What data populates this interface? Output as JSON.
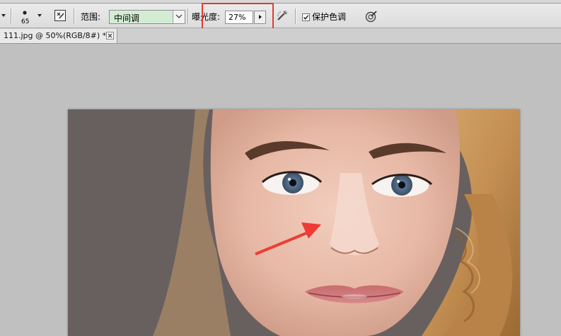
{
  "options_bar": {
    "brush_size": "65",
    "range_label": "范围:",
    "range_value": "中间调",
    "exposure_label": "曝光度:",
    "exposure_value": "27%",
    "protect_tones_label": "保护色调",
    "protect_tones_checked": true
  },
  "document_tab": {
    "title": "111.jpg @ 50%(RGB/8#) *"
  },
  "colors": {
    "canvas_background": "#c0c0c0",
    "range_field": "#d4ecd4",
    "highlight_box": "#e23a34",
    "arrow": "#ef3b33"
  },
  "icons": [
    "tool-preset-picker-icon",
    "brush-picker-icon",
    "brush-panel-toggle-icon",
    "airbrush-icon",
    "pressure-for-size-icon",
    "close-icon"
  ]
}
